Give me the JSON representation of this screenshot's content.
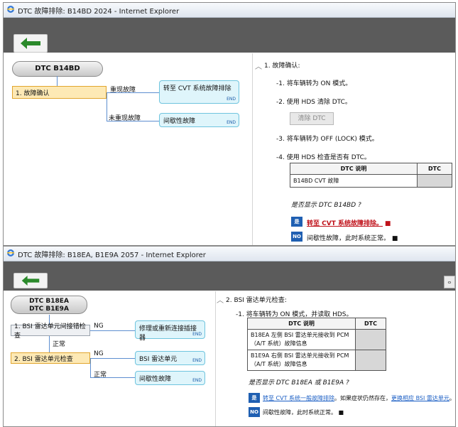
{
  "window1": {
    "title": "DTC 故障排除: B14BD 2024 - Internet Explorer",
    "dtc_pill": "DTC B14BD",
    "step1_label": "1.  故障确认",
    "branch_reproduced": "重现故障",
    "branch_not_reproduced": "未重现故障",
    "result1_text": "转至 CVT 系统故障排除",
    "result2_text": "间歇性故障",
    "end": "END",
    "section_title": "1.  故障确认:",
    "sub1": "-1.   将车辆转为 ON 模式。",
    "sub2": "-2.   使用 HDS 清除 DTC。",
    "clear_dtc_button": "清除  DTC",
    "sub3": "-3.   将车辆转为 OFF (LOCK) 模式。",
    "sub4": "-4.   使用 HDS 检查是否有 DTC。",
    "table_header_desc": "DTC 说明",
    "table_header_dtc": "DTC",
    "table_row_desc": "B14BD CVT 故障",
    "question": "是否显示 DTC B14BD ?",
    "yes_label": "是",
    "yes_link": "转至 CVT 系统故障排除。",
    "yes_end": "■",
    "no_label": "NO",
    "no_text": "间歇性故障，此时系统正常。",
    "no_end": "■"
  },
  "window2": {
    "title": "DTC 故障排除: B18EA, B1E9A 2057 - Internet Explorer",
    "dtc_pill_line1": "DTC B18EA",
    "dtc_pill_line2": "DTC B1E9A",
    "step1_label": "1.  BSI 雷达单元间接错检查",
    "step2_label": "2.  BSI 雷达单元检查",
    "branch_ng1": "NG",
    "branch_normal1": "正常",
    "branch_ng2": "NG",
    "branch_normal2": "正常",
    "result1_text": "修理或重新连接插接器",
    "result2_text": "BSI 雷达单元",
    "result3_text": "间歇性故障",
    "end": "END",
    "section_title": "2.  BSI 雷达单元检查:",
    "sub1": "-1.   将车辆转为 ON 模式，并读取 HDS。",
    "table_header_desc": "DTC 说明",
    "table_header_dtc": "DTC",
    "row1_line1": "B18EA 左侧 BSI 雷达单元接收到 PCM",
    "row1_line2": "（A/T 系统）故障信息",
    "row2_line1": "B1E9A 右侧 BSI 雷达单元接收到 PCM",
    "row2_line2": "（A/T 系统）故障信息",
    "question": "是否显示 DTC B18EA 或 B1E9A ?",
    "yes_label": "是",
    "yes_link": "转至 CVT 系统一般故障排除",
    "yes_mid": "。如果症状仍然存在，",
    "yes_link2": "更换相应 BSI 雷达单元",
    "yes_end": "。■",
    "no_label": "NO",
    "no_text": "间歇性故障，此时系统正常。",
    "no_end": "■",
    "scroll_glyph": "ⴰ"
  },
  "colors": {
    "toolbar": "#5b5b5b",
    "back_arrow": "#2b8a2b",
    "active_step": "#fde9b5",
    "result_box": "#dff5fb",
    "flow_line": "#5d8ed0",
    "yes_no": "#1f5fb2",
    "link_red": "#c0131b"
  }
}
